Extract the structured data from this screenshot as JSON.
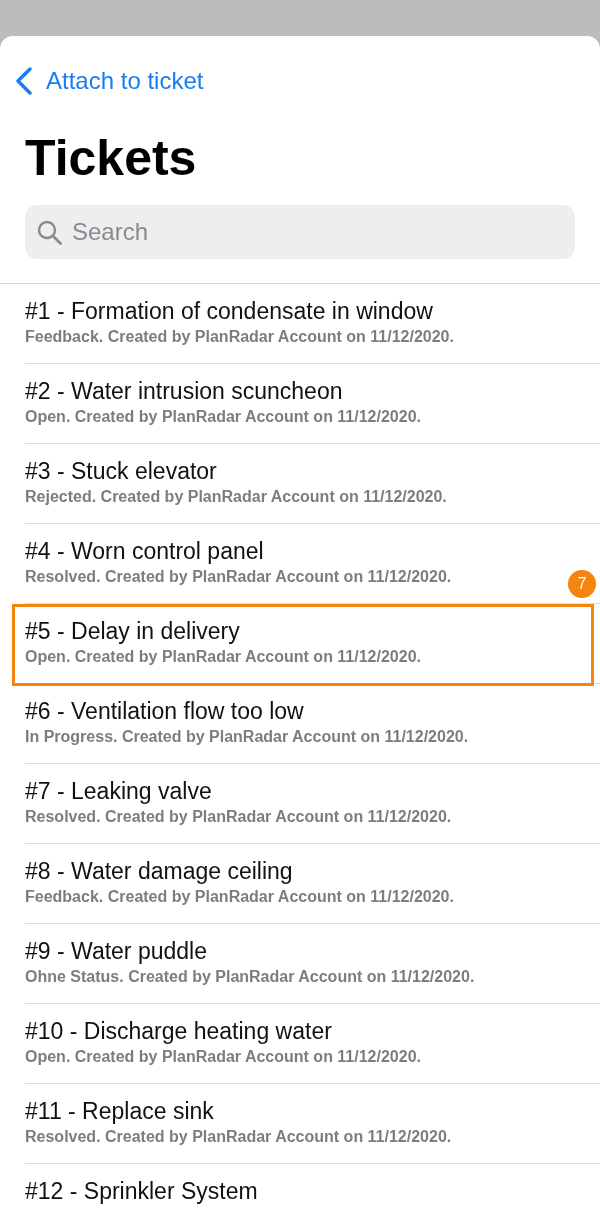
{
  "nav": {
    "back_label": "Attach to ticket"
  },
  "title": "Tickets",
  "search": {
    "placeholder": "Search"
  },
  "tickets": [
    {
      "title": "#1 - Formation of condensate in window",
      "subtitle": "Feedback. Created by PlanRadar Account on 11/12/2020.",
      "highlighted": false
    },
    {
      "title": "#2 - Water intrusion scuncheon",
      "subtitle": "Open. Created by PlanRadar Account on 11/12/2020.",
      "highlighted": false
    },
    {
      "title": "#3 - Stuck elevator",
      "subtitle": "Rejected. Created by PlanRadar Account on 11/12/2020.",
      "highlighted": false
    },
    {
      "title": "#4 - Worn control panel",
      "subtitle": "Resolved. Created by PlanRadar Account on 11/12/2020.",
      "highlighted": false
    },
    {
      "title": "#5 - Delay in delivery",
      "subtitle": "Open. Created by PlanRadar Account on 11/12/2020.",
      "highlighted": true,
      "badge": "7"
    },
    {
      "title": "#6 - Ventilation flow too low",
      "subtitle": "In Progress. Created by PlanRadar Account on 11/12/2020.",
      "highlighted": false
    },
    {
      "title": "#7 - Leaking valve",
      "subtitle": "Resolved. Created by PlanRadar Account on 11/12/2020.",
      "highlighted": false
    },
    {
      "title": "#8 - Water damage ceiling",
      "subtitle": "Feedback. Created by PlanRadar Account on 11/12/2020.",
      "highlighted": false
    },
    {
      "title": "#9 - Water puddle",
      "subtitle": "Ohne Status. Created by PlanRadar Account on 11/12/2020.",
      "highlighted": false
    },
    {
      "title": "#10 - Discharge heating water",
      "subtitle": "Open. Created by PlanRadar Account on 11/12/2020.",
      "highlighted": false
    },
    {
      "title": "#11 - Replace sink",
      "subtitle": "Resolved. Created by PlanRadar Account on 11/12/2020.",
      "highlighted": false
    },
    {
      "title": "#12 - Sprinkler System",
      "highlighted": false
    }
  ]
}
